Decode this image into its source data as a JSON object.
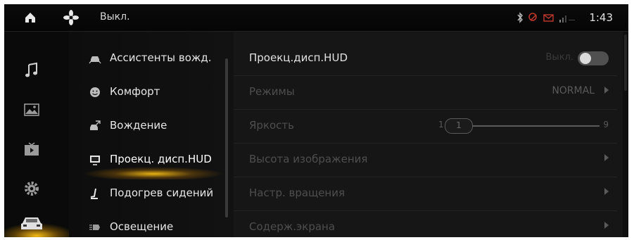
{
  "status_bar": {
    "fan_state": "Выкл.",
    "time": "1:43"
  },
  "rail": {
    "items": [
      "music-icon",
      "gallery-icon",
      "video-icon",
      "settings-icon",
      "car-icon"
    ],
    "active": "car-icon",
    "accent_color": "#ffc414"
  },
  "categories": {
    "items": [
      {
        "label": "Ассистенты вожд.",
        "icon": "driver-assist-icon"
      },
      {
        "label": "Комфорт",
        "icon": "comfort-icon"
      },
      {
        "label": "Вождение",
        "icon": "driving-icon"
      },
      {
        "label": "Проекц. дисп.HUD",
        "icon": "hud-icon"
      },
      {
        "label": "Подогрев сидений",
        "icon": "seat-heating-icon"
      },
      {
        "label": "Освещение",
        "icon": "lighting-icon"
      }
    ],
    "active_index": 3
  },
  "settings": {
    "hud": {
      "label": "Проекц.дисп.HUD",
      "toggle_text": "Выкл."
    },
    "mode": {
      "label": "Режимы",
      "value": "NORMAL"
    },
    "brightness": {
      "label": "Яркость",
      "min": "1",
      "value": "1",
      "max": "9"
    },
    "height": {
      "label": "Высота изображения"
    },
    "rotation": {
      "label": "Настр. вращения"
    },
    "content": {
      "label": "Содерж.экрана"
    }
  }
}
